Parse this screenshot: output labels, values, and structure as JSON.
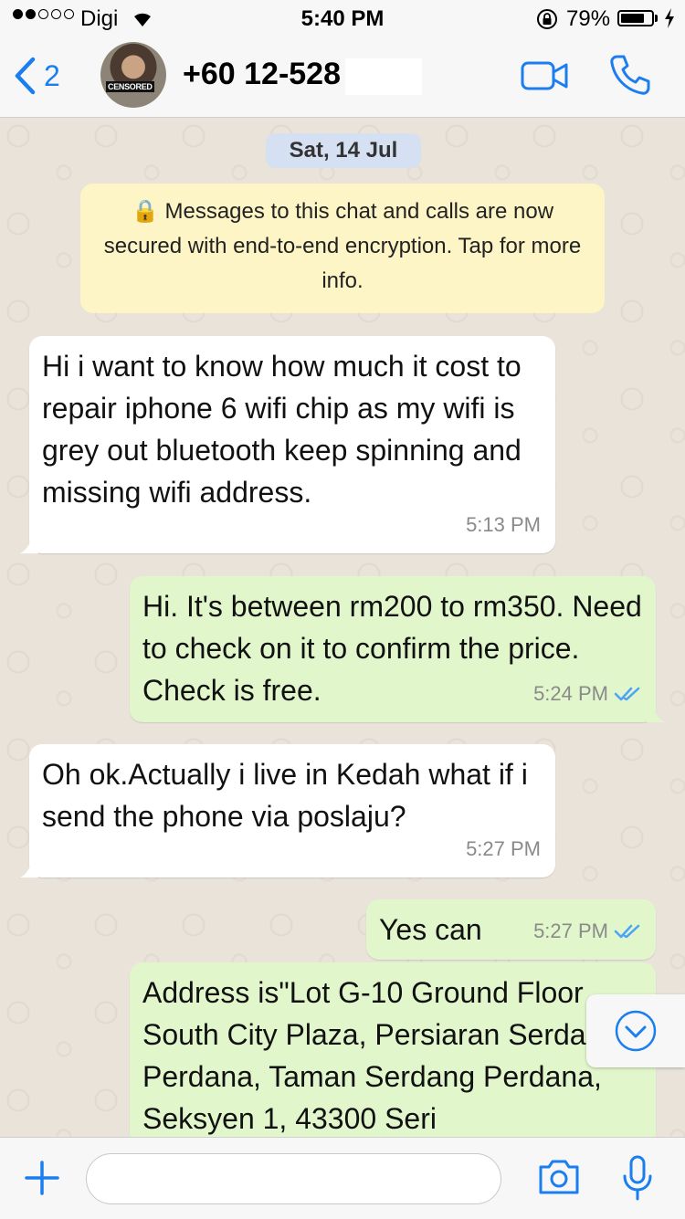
{
  "status_bar": {
    "carrier": "Digi",
    "time": "5:40 PM",
    "battery_percent": "79%",
    "battery_level": 0.79,
    "signal_bars_filled": 2,
    "signal_bars_total": 5
  },
  "nav": {
    "back_count": "2",
    "avatar_censor_label": "CENSORED",
    "contact_number": "+60 12-528"
  },
  "chat": {
    "date_label": "Sat, 14 Jul",
    "encryption_notice": "🔒 Messages to this chat and calls are now secured with end-to-end encryption. Tap for more info.",
    "messages": [
      {
        "direction": "in",
        "text": "Hi i want to know how much it cost to repair iphone 6 wifi chip as my wifi is grey out bluetooth keep spinning and missing wifi address.",
        "time": "5:13 PM"
      },
      {
        "direction": "out",
        "text": "Hi. It's between rm200 to rm350. Need to check on it to confirm the price.  Check is free.",
        "time": "5:24 PM",
        "status": "read"
      },
      {
        "direction": "in",
        "text": "Oh ok.Actually i live in Kedah what if i send the phone via poslaju?",
        "time": "5:27 PM"
      },
      {
        "direction": "out",
        "text": "Yes can",
        "time": "5:27 PM",
        "status": "read"
      },
      {
        "direction": "out",
        "text": "Address is\"Lot G-10 Ground Floor South City Plaza, Persiaran Serdang Perdana, Taman Serdang Perdana, Seksyen 1, 43300 Seri",
        "time": ""
      }
    ]
  },
  "input_bar": {
    "message_value": "",
    "message_placeholder": ""
  },
  "colors": {
    "accent": "#1a7ef1",
    "outgoing_bubble": "#e1f7cb",
    "incoming_bubble": "#ffffff",
    "read_ticks": "#4fa3f7",
    "date_pill": "#d5e1f2",
    "notice_bg": "#fdf5c5"
  },
  "icons": [
    "back-chevron-icon",
    "video-call-icon",
    "phone-call-icon",
    "scroll-down-icon",
    "plus-icon",
    "camera-icon",
    "microphone-icon",
    "double-check-icon",
    "lock-icon",
    "wifi-icon",
    "battery-icon",
    "charging-icon"
  ]
}
